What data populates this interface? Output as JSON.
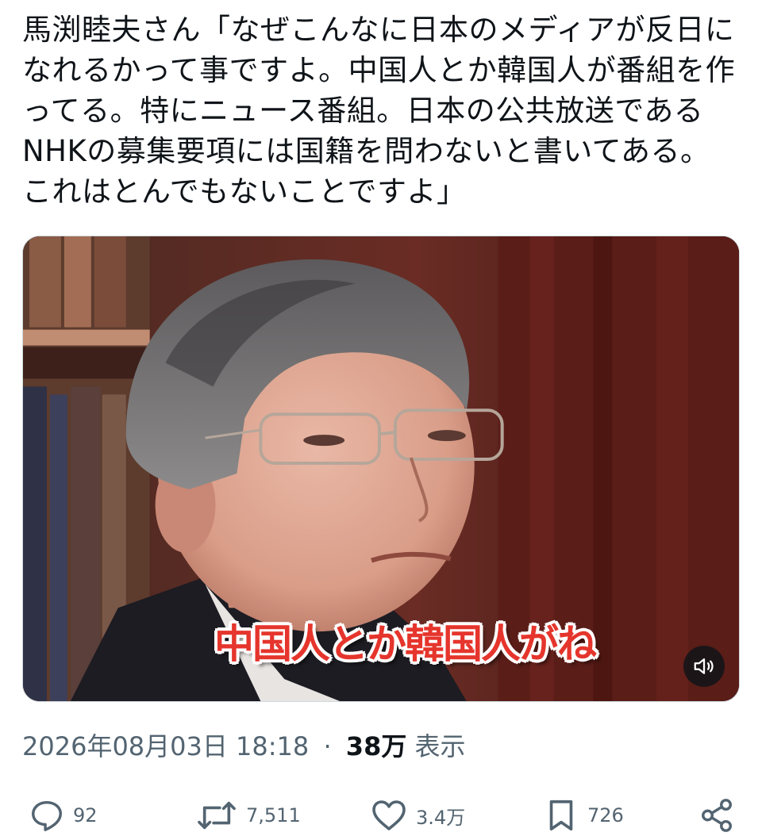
{
  "tweet": {
    "text": "馬渕睦夫さん「なぜこんなに日本のメディアが反日になれるかって事ですよ。中国人とか韓国人が番組を作ってる。特にニュース番組。日本の公共放送であるNHKの募集要項には国籍を問わないと書いてある。これはとんでもないことですよ」"
  },
  "media": {
    "caption": "中国人とか韓国人がね",
    "mute_icon": "speaker-muted-icon"
  },
  "meta": {
    "timestamp": "2026年08月03日 18:18",
    "separator": "·",
    "views_count": "38万",
    "views_label": "表示"
  },
  "actions": {
    "reply": {
      "icon": "reply-icon",
      "count": "92"
    },
    "retweet": {
      "icon": "retweet-icon",
      "count": "7,511"
    },
    "like": {
      "icon": "heart-icon",
      "count": "3.4万"
    },
    "bookmark": {
      "icon": "bookmark-icon",
      "count": "726"
    },
    "share": {
      "icon": "share-icon"
    }
  },
  "colors": {
    "text_primary": "#0f1419",
    "text_secondary": "#536471",
    "caption_red": "#e5352c"
  }
}
